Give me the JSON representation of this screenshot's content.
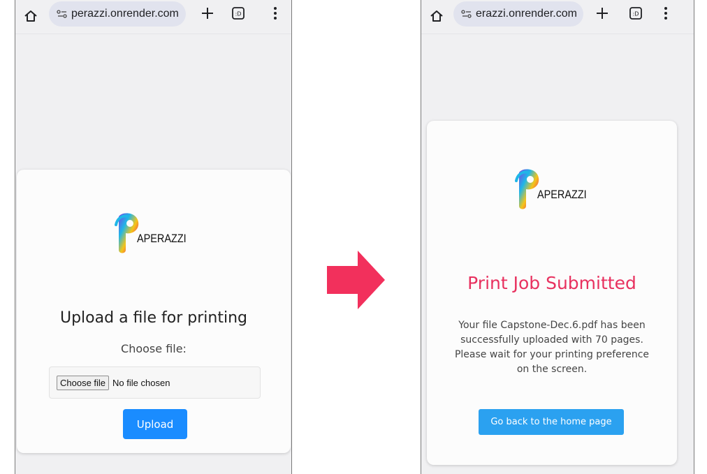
{
  "left_screen": {
    "browser": {
      "url": "perazzi.onrender.com",
      "icons": [
        "home-icon",
        "site-settings-icon",
        "new-tab-plus-icon",
        "tab-switcher-icon",
        "overflow-menu-icon"
      ]
    },
    "logo_text": "APERAZZI",
    "title": "Upload a file for printing",
    "choose_label": "Choose file:",
    "file_button": "Choose file",
    "file_status": "No file chosen",
    "upload_button": "Upload"
  },
  "right_screen": {
    "browser": {
      "url": "erazzi.onrender.com",
      "icons": [
        "home-icon",
        "site-settings-icon",
        "new-tab-plus-icon",
        "tab-switcher-icon",
        "overflow-menu-icon"
      ]
    },
    "logo_text": "APERAZZI",
    "title": "Print Job Submitted",
    "message_lines": [
      "Your file Capstone-Dec.6.pdf has been",
      "successfully uploaded with 70 pages.",
      "Please wait for your printing preference",
      "on the screen."
    ],
    "home_button": "Go back to the home page"
  },
  "transition": {
    "icon": "right-arrow-icon"
  },
  "colors": {
    "page_bg": "#f0f0f2",
    "card_bg": "#fcfcfc",
    "upload_button": "#1a8cff",
    "home_button": "#2ba1f0",
    "accent_title": "#e8315f",
    "arrow": "#f2305c"
  }
}
